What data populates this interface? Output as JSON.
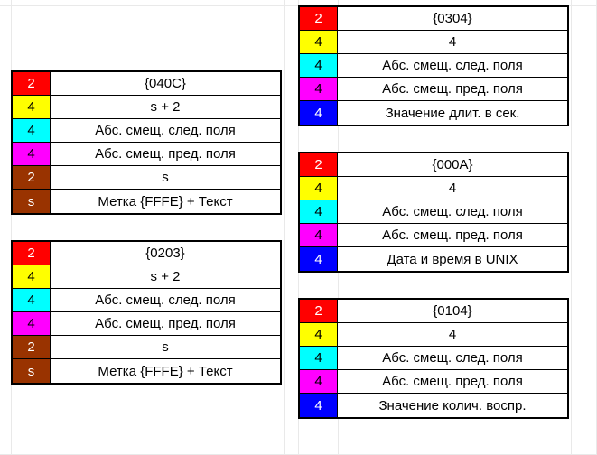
{
  "colors": {
    "red": "#ff0000",
    "yellow": "#ffff00",
    "cyan": "#00ffff",
    "magenta": "#ff00ff",
    "brown": "#993300",
    "blue": "#0000ff"
  },
  "left": [
    {
      "rows": [
        {
          "size": "2",
          "color": "red",
          "desc": "{040C}"
        },
        {
          "size": "4",
          "color": "yellow",
          "desc": "s + 2"
        },
        {
          "size": "4",
          "color": "cyan",
          "desc": "Абс. смещ. след. поля"
        },
        {
          "size": "4",
          "color": "magenta",
          "desc": "Абс. смещ. пред. поля"
        },
        {
          "size": "2",
          "color": "brown",
          "desc": "s"
        },
        {
          "size": "s",
          "color": "brown",
          "desc": "Метка {FFFE} + Текст"
        }
      ]
    },
    {
      "rows": [
        {
          "size": "2",
          "color": "red",
          "desc": "{0203}"
        },
        {
          "size": "4",
          "color": "yellow",
          "desc": "s + 2"
        },
        {
          "size": "4",
          "color": "cyan",
          "desc": "Абс. смещ. след. поля"
        },
        {
          "size": "4",
          "color": "magenta",
          "desc": "Абс. смещ. пред. поля"
        },
        {
          "size": "2",
          "color": "brown",
          "desc": "s"
        },
        {
          "size": "s",
          "color": "brown",
          "desc": "Метка {FFFE} + Текст"
        }
      ]
    }
  ],
  "right": [
    {
      "rows": [
        {
          "size": "2",
          "color": "red",
          "desc": "{0304}"
        },
        {
          "size": "4",
          "color": "yellow",
          "desc": "4"
        },
        {
          "size": "4",
          "color": "cyan",
          "desc": "Абс. смещ. след. поля"
        },
        {
          "size": "4",
          "color": "magenta",
          "desc": "Абс. смещ. пред. поля"
        },
        {
          "size": "4",
          "color": "blue",
          "desc": "Значение длит. в сек."
        }
      ]
    },
    {
      "rows": [
        {
          "size": "2",
          "color": "red",
          "desc": "{000A}"
        },
        {
          "size": "4",
          "color": "yellow",
          "desc": "4"
        },
        {
          "size": "4",
          "color": "cyan",
          "desc": "Абс. смещ. след. поля"
        },
        {
          "size": "4",
          "color": "magenta",
          "desc": "Абс. смещ. пред. поля"
        },
        {
          "size": "4",
          "color": "blue",
          "desc": "Дата и время в UNIX"
        }
      ]
    },
    {
      "rows": [
        {
          "size": "2",
          "color": "red",
          "desc": "{0104}"
        },
        {
          "size": "4",
          "color": "yellow",
          "desc": "4"
        },
        {
          "size": "4",
          "color": "cyan",
          "desc": "Абс. смещ. след. поля"
        },
        {
          "size": "4",
          "color": "magenta",
          "desc": "Абс. смещ. пред. поля"
        },
        {
          "size": "4",
          "color": "blue",
          "desc": "Значение колич. воспр."
        }
      ]
    }
  ]
}
